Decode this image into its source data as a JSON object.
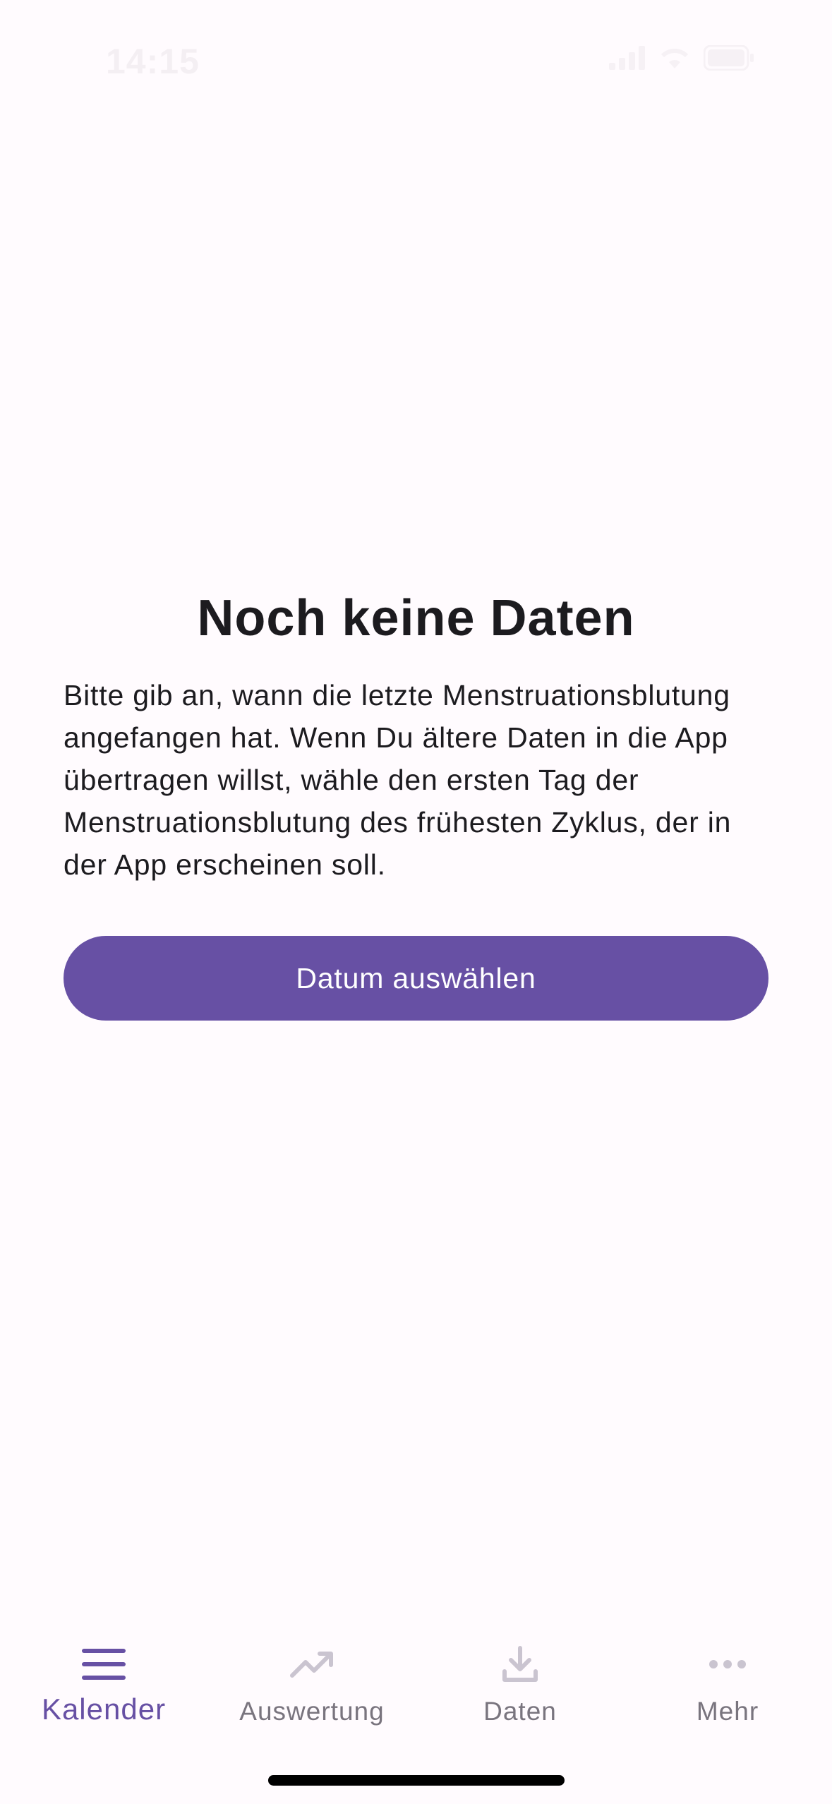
{
  "status_bar": {
    "time": "14:15"
  },
  "empty_state": {
    "title": "Noch keine Daten",
    "body": "Bitte gib an, wann die letzte Menstruationsblutung angefangen hat. Wenn Du ältere Daten in die App übertragen willst, wähle den ersten Tag der Menstruationsblutung des frühesten Zyklus, der in der App erscheinen soll.",
    "button_label": "Datum auswählen"
  },
  "bottom_nav": {
    "items": [
      {
        "label": "Kalender",
        "icon": "menu-icon",
        "active": true
      },
      {
        "label": "Auswertung",
        "icon": "trending-up-icon",
        "active": false
      },
      {
        "label": "Daten",
        "icon": "download-icon",
        "active": false
      },
      {
        "label": "Mehr",
        "icon": "more-horizontal-icon",
        "active": false
      }
    ]
  },
  "colors": {
    "background": "#fffbfe",
    "primary": "#6750a4",
    "text": "#1c1b1f",
    "inactive_label": "#79747e",
    "inactive_icon": "#cac4d0"
  }
}
